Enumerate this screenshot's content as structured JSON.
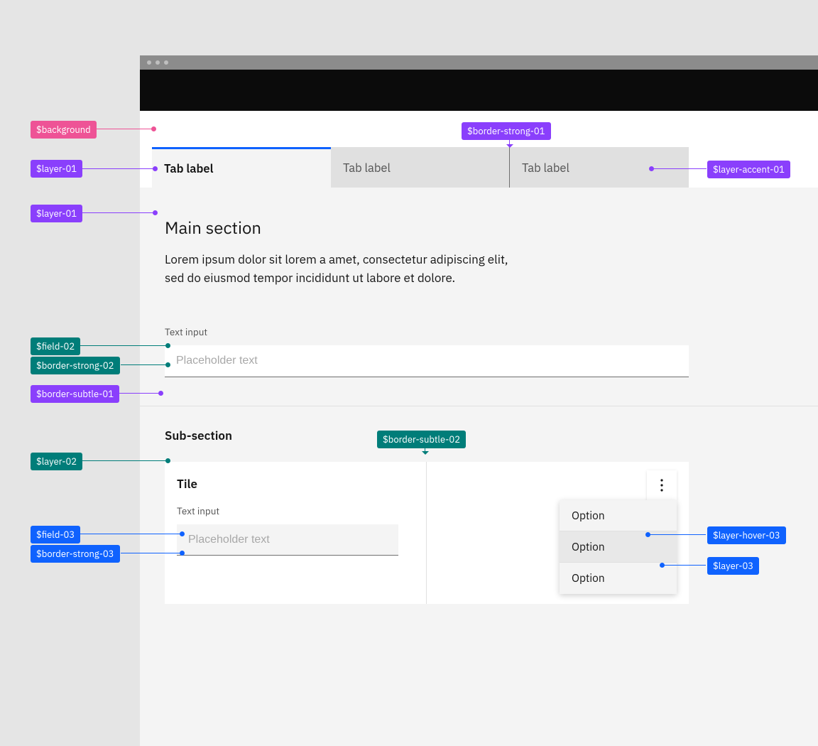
{
  "tabs": {
    "items": [
      {
        "label": "Tab label"
      },
      {
        "label": "Tab label"
      },
      {
        "label": "Tab label"
      }
    ]
  },
  "main": {
    "heading": "Main section",
    "body": "Lorem ipsum dolor sit lorem a amet, consectetur adipiscing elit, sed do eiusmod tempor incididunt ut labore et dolore.",
    "input_label": "Text input",
    "input_placeholder": "Placeholder text"
  },
  "sub": {
    "heading": "Sub-section",
    "tile_title": "Tile",
    "tile_input_label": "Text input",
    "tile_input_placeholder": "Placeholder text"
  },
  "menu": {
    "items": [
      {
        "label": "Option"
      },
      {
        "label": "Option"
      },
      {
        "label": "Option"
      }
    ]
  },
  "annotations": {
    "background": "$background",
    "layer_01_tab": "$layer-01",
    "layer_01_panel": "$layer-01",
    "border_strong_01": "$border-strong-01",
    "layer_accent_01": "$layer-accent-01",
    "field_02": "$field-02",
    "border_strong_02": "$border-strong-02",
    "border_subtle_01": "$border-subtle-01",
    "border_subtle_02": "$border-subtle-02",
    "layer_02": "$layer-02",
    "field_03": "$field-03",
    "border_strong_03": "$border-strong-03",
    "layer_hover_03": "$layer-hover-03",
    "layer_03": "$layer-03"
  },
  "colors": {
    "pink": "#ee5396",
    "purple": "#8a3ffc",
    "teal": "#007d79",
    "blue": "#0f62fe",
    "tab_active_border": "#0f62fe"
  }
}
